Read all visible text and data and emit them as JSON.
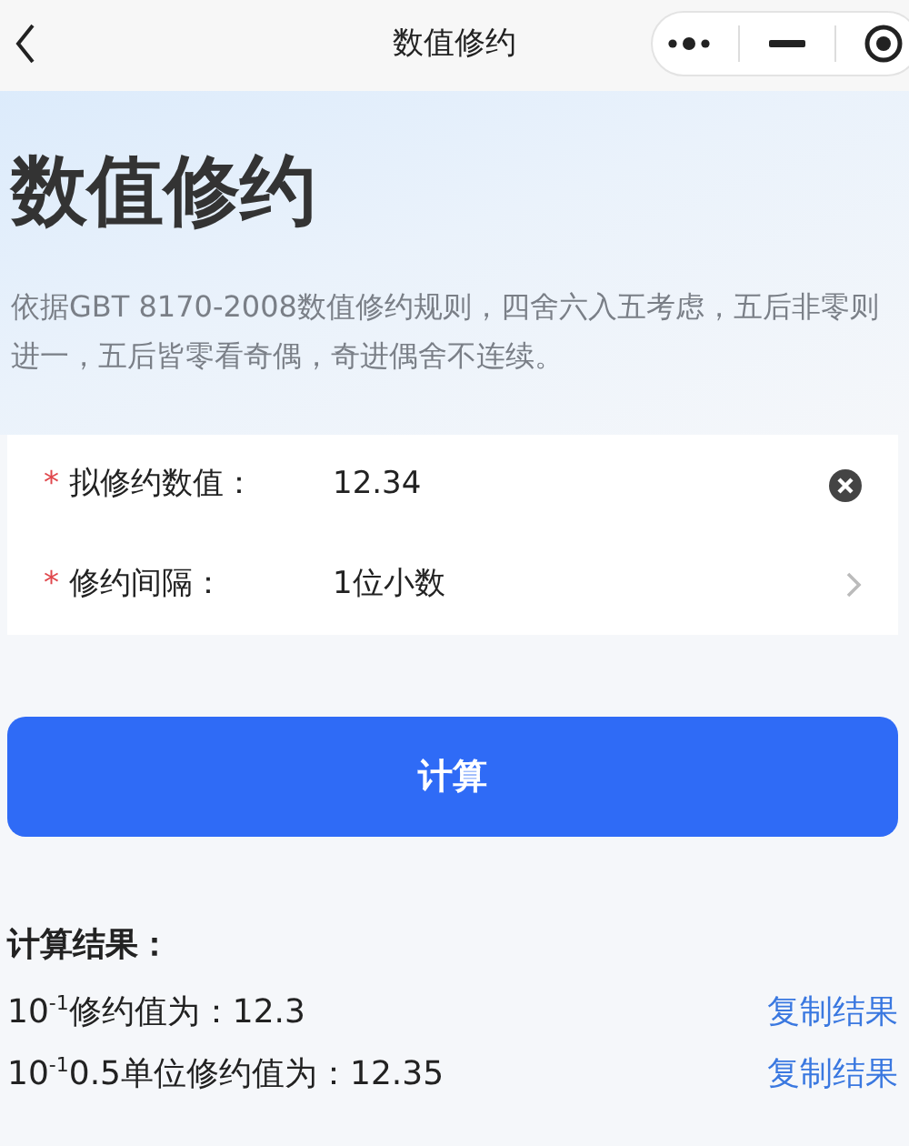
{
  "nav": {
    "title": "数值修约"
  },
  "heading": "数值修约",
  "description": "依据GBT 8170-2008数值修约规则，四舍六入五考虑，五后非零则进一，五后皆零看奇偶，奇进偶舍不连续。",
  "form": [
    {
      "kind": "input",
      "required_mark": "*",
      "label": "拟修约数值：",
      "value": "12.34"
    },
    {
      "kind": "select",
      "required_mark": "*",
      "label": "修约间隔：",
      "value": "1位小数"
    }
  ],
  "button": "计算",
  "results": {
    "title": "计算结果：",
    "rows": [
      {
        "text": "10$^{-1}$修约值为：12.3",
        "action": "复制结果"
      },
      {
        "text": "10$^{-1}$0.5单位修约值为：12.35",
        "action": "复制结果"
      }
    ]
  }
}
